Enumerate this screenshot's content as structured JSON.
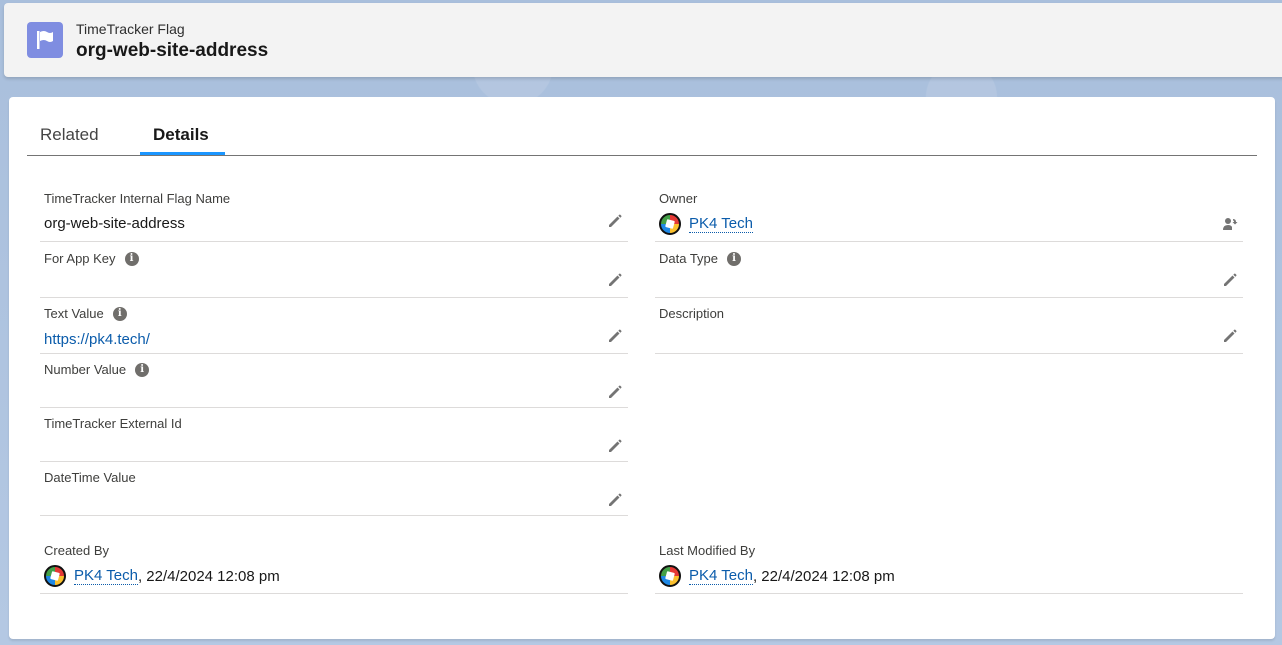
{
  "header": {
    "entity_label": "TimeTracker Flag",
    "record_title": "org-web-site-address",
    "icon": "flag-icon"
  },
  "tabs": [
    {
      "label": "Related",
      "active": false
    },
    {
      "label": "Details",
      "active": true
    }
  ],
  "fields": {
    "internal_flag_name": {
      "label": "TimeTracker Internal Flag Name",
      "value": "org-web-site-address"
    },
    "owner": {
      "label": "Owner",
      "value": "PK4 Tech"
    },
    "for_app_key": {
      "label": "For App Key",
      "value": ""
    },
    "data_type": {
      "label": "Data Type",
      "value": ""
    },
    "text_value": {
      "label": "Text Value",
      "value": "https://pk4.tech/"
    },
    "description": {
      "label": "Description",
      "value": ""
    },
    "number_value": {
      "label": "Number Value",
      "value": ""
    },
    "external_id": {
      "label": "TimeTracker External Id",
      "value": ""
    },
    "datetime_value": {
      "label": "DateTime Value",
      "value": ""
    },
    "created_by": {
      "label": "Created By",
      "user": "PK4 Tech",
      "timestamp": ", 22/4/2024 12:08 pm"
    },
    "last_modified_by": {
      "label": "Last Modified By",
      "user": "PK4 Tech",
      "timestamp": ", 22/4/2024 12:08 pm"
    }
  },
  "colors": {
    "accent": "#1b96ff",
    "link": "#0b5cab",
    "header_icon_bg": "#7f8de1"
  }
}
